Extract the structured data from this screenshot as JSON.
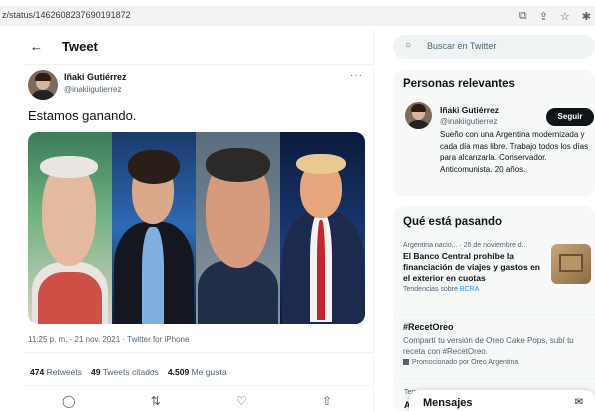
{
  "browser": {
    "url": "z/status/1462608237690191872",
    "icons": [
      "page-icon",
      "share-icon",
      "star-icon",
      "extension-icon"
    ]
  },
  "header": {
    "title": "Tweet",
    "back_icon": "arrow-left-icon"
  },
  "tweet": {
    "author_name": "Iñaki Gutiérrez",
    "author_handle": "@inakiigutierrez",
    "text": "Estamos ganando.",
    "meta": "11:25 p. m. · 21 nov. 2021 · Twitter for iPhone",
    "retweets_count": "474",
    "retweets_label": "Retweets",
    "quotes_count": "49",
    "quotes_label": "Tweets citados",
    "likes_count": "4.509",
    "likes_label": "Me gusta"
  },
  "sidebar": {
    "search_placeholder": "Buscar en Twitter",
    "relevant_title": "Personas relevantes",
    "relevant_person": {
      "name": "Iñaki Gutiérrez",
      "handle": "@inakiigutierrez",
      "follow_label": "Seguir",
      "bio": "Sueño con una Argentina modernizada y cada día mas libre. Trabajo todos los días para alcanzarla. Conservador. Anticomunista. 20 años."
    },
    "trends_title": "Qué está pasando",
    "trends": [
      {
        "context": "Argentina nacio... · 26 de noviembre d...",
        "title": "El Banco Central prohíbe la financiación de viajes y gastos en el exterior en cuotas",
        "footer_prefix": "Tendencias sobre",
        "footer_link": "BCRA"
      },
      {
        "context": "",
        "title": "#RecetOreo",
        "body": "Compartí tu versión de Oreo Cake Pops, subí tu receta con #RecetOreo.",
        "footer": "Promocionado por Oreo Argentina"
      }
    ],
    "partial_context": "Tem",
    "partial_title": "Ar"
  },
  "messages": {
    "title": "Mensajes"
  }
}
